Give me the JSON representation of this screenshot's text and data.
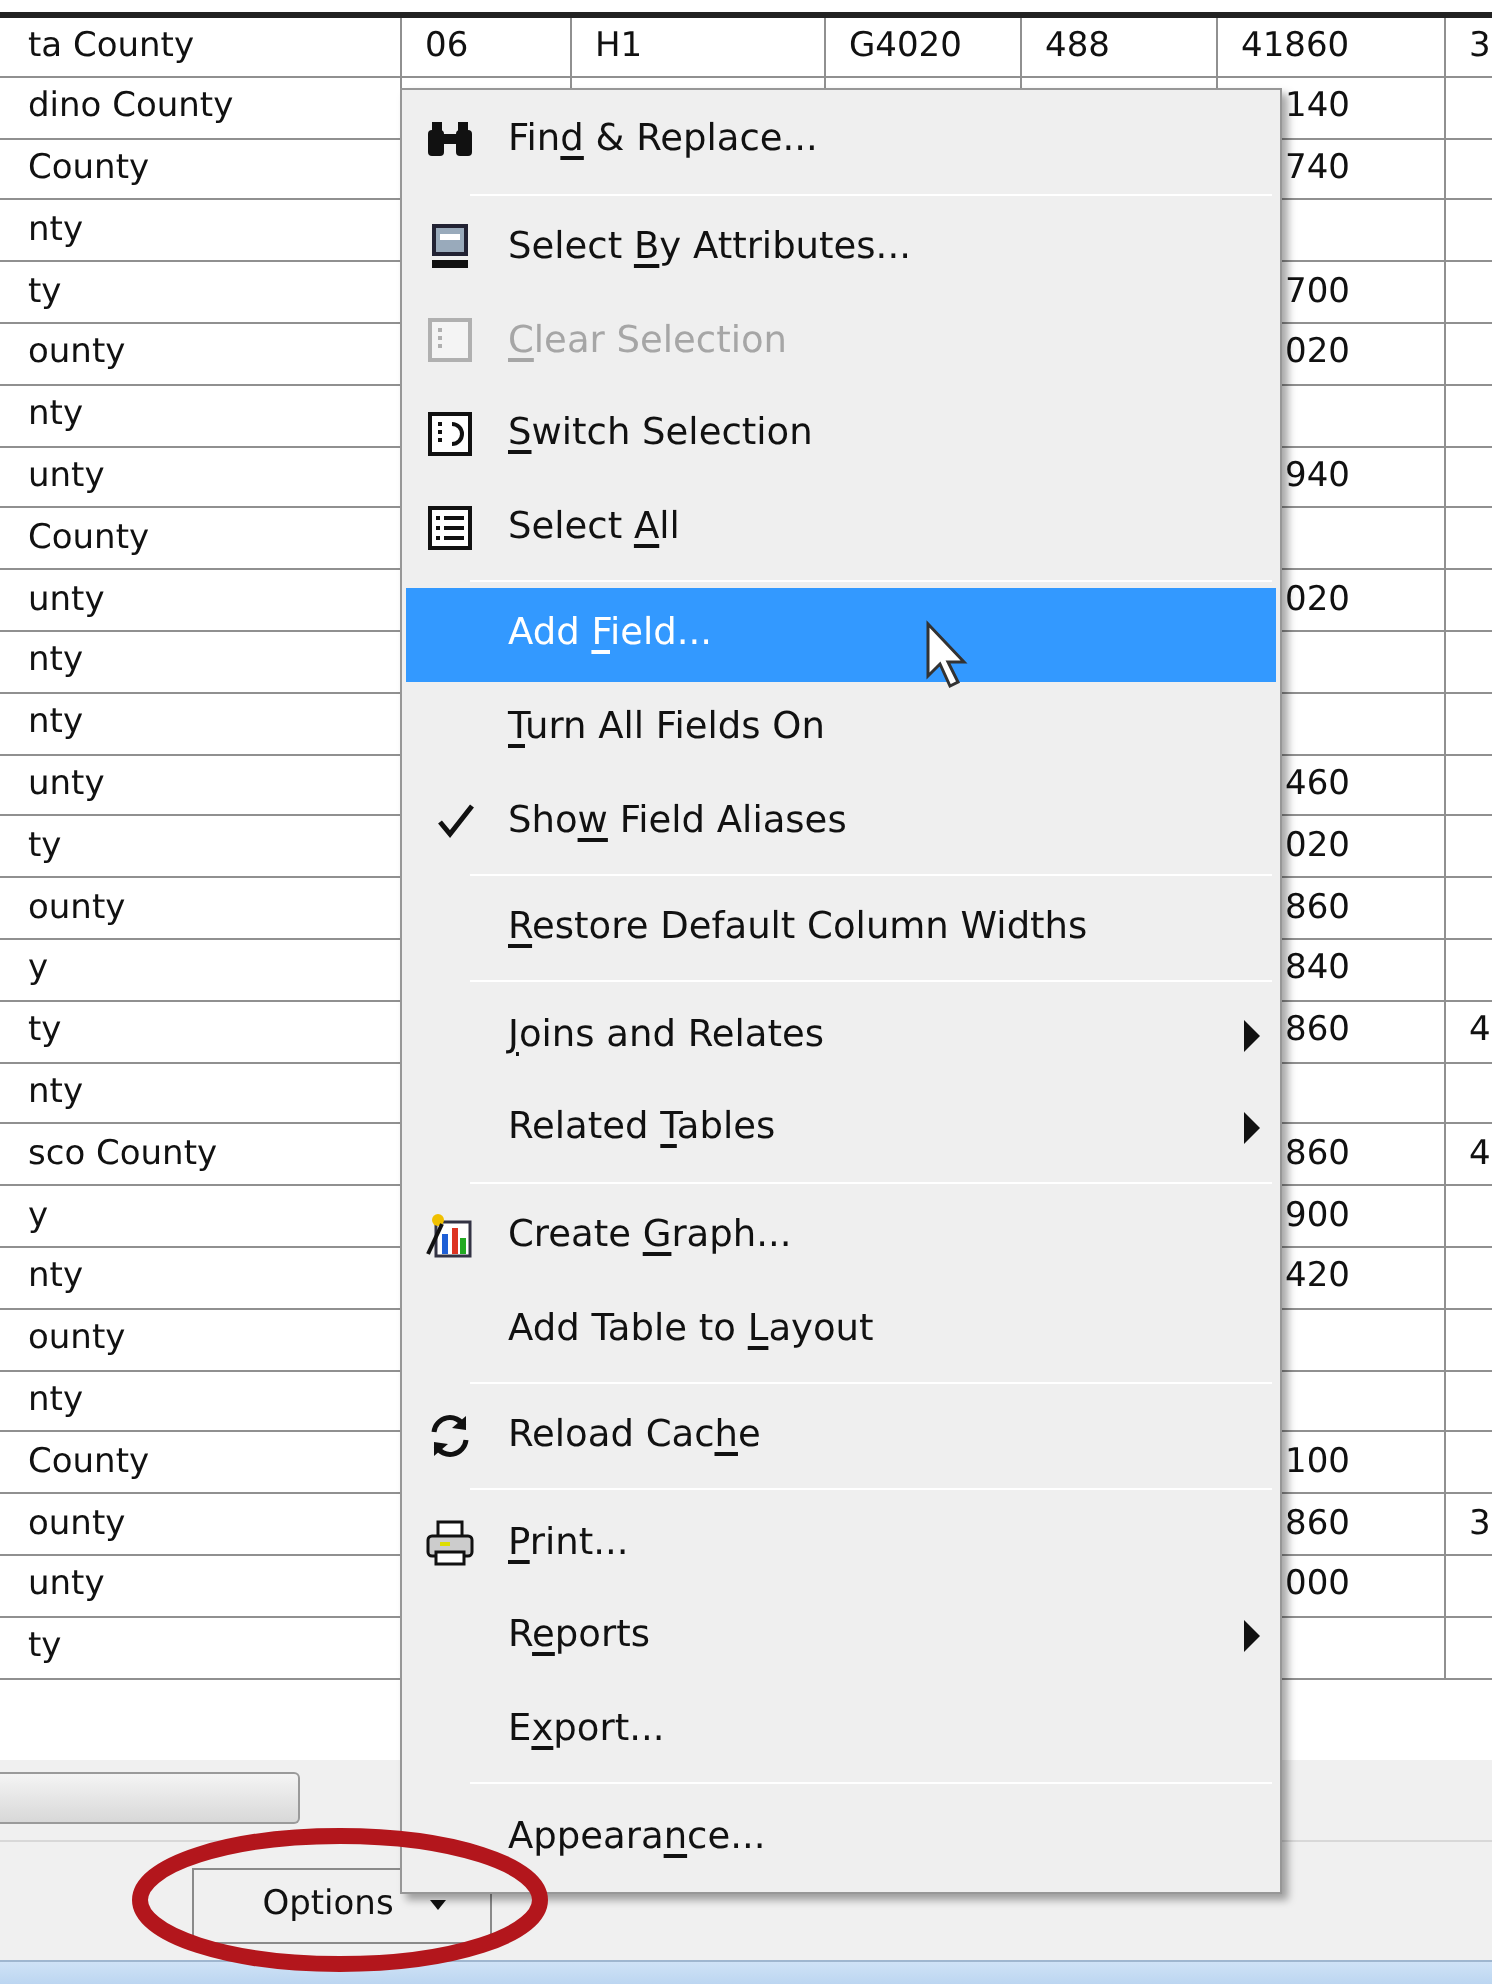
{
  "table": {
    "rows": [
      {
        "column_1": "ta County",
        "column_2": "06",
        "column_3": "H1",
        "column_4": "G4020",
        "column_5": "488",
        "column_6": "41860",
        "column_7": "3"
      },
      {
        "column_1": "dino County",
        "column_6": "140"
      },
      {
        "column_1": "County",
        "column_6": "740"
      },
      {
        "column_1": "nty"
      },
      {
        "column_1": "ty",
        "column_6": "700"
      },
      {
        "column_1": "ounty",
        "column_6": "020"
      },
      {
        "column_1": "nty"
      },
      {
        "column_1": "unty",
        "column_6": "940"
      },
      {
        "column_1": "County"
      },
      {
        "column_1": "unty",
        "column_6": "020"
      },
      {
        "column_1": "nty"
      },
      {
        "column_1": "nty"
      },
      {
        "column_1": "unty",
        "column_6": "460"
      },
      {
        "column_1": "ty",
        "column_6": "020"
      },
      {
        "column_1": "ounty",
        "column_6": "860"
      },
      {
        "column_1": "y",
        "column_6": "840"
      },
      {
        "column_1": "ty",
        "column_6": "860",
        "column_7": "4"
      },
      {
        "column_1": "nty"
      },
      {
        "column_1": "sco County",
        "column_6": "860",
        "column_7": "4"
      },
      {
        "column_1": "y",
        "column_6": "900"
      },
      {
        "column_1": "nty",
        "column_6": "420"
      },
      {
        "column_1": "ounty"
      },
      {
        "column_1": "nty"
      },
      {
        "column_1": "County",
        "column_6": "100"
      },
      {
        "column_1": "ounty",
        "column_6": "860",
        "column_7": "3"
      },
      {
        "column_1": "unty",
        "column_6": "000"
      },
      {
        "column_1": "ty"
      }
    ]
  },
  "menu": {
    "items": [
      {
        "kind": "item",
        "label": {
          "before": "Fin",
          "key": "d",
          "after": " & Replace..."
        },
        "selected": false,
        "checked": false,
        "disabled": false,
        "submenu": false
      },
      {
        "kind": "separator"
      },
      {
        "kind": "item",
        "label": {
          "before": "Select ",
          "key": "B",
          "after": "y Attributes..."
        },
        "selected": false,
        "checked": false,
        "disabled": false,
        "submenu": false
      },
      {
        "kind": "item",
        "label": {
          "key": "C",
          "after": "lear Selection"
        },
        "selected": false,
        "checked": false,
        "disabled": true,
        "submenu": false
      },
      {
        "kind": "item",
        "label": {
          "key": "S",
          "after": "witch Selection"
        },
        "selected": false,
        "checked": false,
        "disabled": false,
        "submenu": false
      },
      {
        "kind": "item",
        "label": {
          "before": "Select ",
          "key": "A",
          "after": "ll"
        },
        "selected": false,
        "checked": false,
        "disabled": false,
        "submenu": false
      },
      {
        "kind": "separator"
      },
      {
        "kind": "item",
        "label": {
          "before": "Add ",
          "key": "F",
          "after": "ield..."
        },
        "selected": true,
        "checked": false,
        "disabled": false,
        "submenu": false
      },
      {
        "kind": "item",
        "label": {
          "key": "T",
          "after": "urn All Fields On"
        },
        "selected": false,
        "checked": false,
        "disabled": false,
        "submenu": false
      },
      {
        "kind": "item",
        "label": {
          "before": "Sho",
          "key": "w",
          "after": " Field Aliases"
        },
        "selected": false,
        "checked": true,
        "disabled": false,
        "submenu": false
      },
      {
        "kind": "separator"
      },
      {
        "kind": "item",
        "label": {
          "key": "R",
          "after": "estore Default Column Widths"
        },
        "selected": false,
        "checked": false,
        "disabled": false,
        "submenu": false
      },
      {
        "kind": "separator"
      },
      {
        "kind": "item",
        "label": {
          "key": "J",
          "after": "oins and Relates"
        },
        "selected": false,
        "checked": false,
        "disabled": false,
        "submenu": true
      },
      {
        "kind": "item",
        "label": {
          "before": "Related ",
          "key": "T",
          "after": "ables"
        },
        "selected": false,
        "checked": false,
        "disabled": false,
        "submenu": true
      },
      {
        "kind": "separator"
      },
      {
        "kind": "item",
        "label": {
          "before": "Create ",
          "key": "G",
          "after": "raph..."
        },
        "selected": false,
        "checked": false,
        "disabled": false,
        "submenu": false
      },
      {
        "kind": "item",
        "label": {
          "before": "Add Table to ",
          "key": "L",
          "after": "ayout"
        },
        "selected": false,
        "checked": false,
        "disabled": false,
        "submenu": false
      },
      {
        "kind": "separator"
      },
      {
        "kind": "item",
        "label": {
          "before": "Reload Cac",
          "key": "h",
          "after": "e"
        },
        "selected": false,
        "checked": false,
        "disabled": false,
        "submenu": false
      },
      {
        "kind": "separator"
      },
      {
        "kind": "item",
        "label": {
          "key": "P",
          "after": "rint..."
        },
        "selected": false,
        "checked": false,
        "disabled": false,
        "submenu": false
      },
      {
        "kind": "item",
        "label": {
          "before": "R",
          "key": "e",
          "after": "ports"
        },
        "selected": false,
        "checked": false,
        "disabled": false,
        "submenu": true
      },
      {
        "kind": "item",
        "label": {
          "before": "E",
          "key": "x",
          "after": "port..."
        },
        "selected": false,
        "checked": false,
        "disabled": false,
        "submenu": false
      },
      {
        "kind": "separator"
      },
      {
        "kind": "item",
        "label": {
          "before": "Appeara",
          "key": "n",
          "after": "ce..."
        },
        "selected": false,
        "checked": false,
        "disabled": false,
        "submenu": false
      }
    ]
  },
  "toolbar": {
    "options_button": "Options"
  }
}
